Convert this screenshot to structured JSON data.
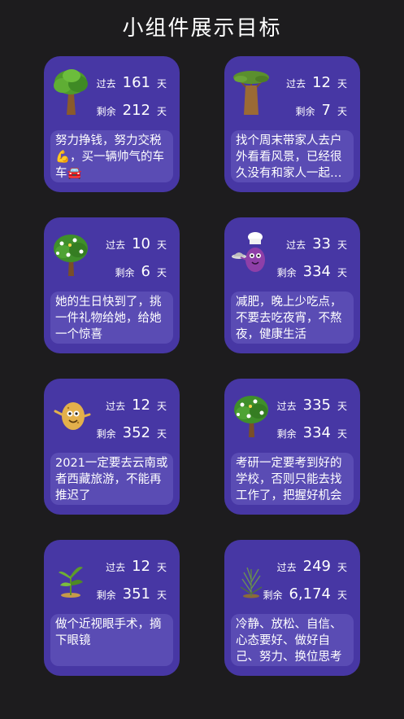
{
  "title": "小组件展示目标",
  "colors": {
    "background": "#1d1c1e",
    "card": "#4737a4",
    "memo": "#5a4cb4"
  },
  "cards": [
    {
      "icon": "tree-icon",
      "passed_label": "过去",
      "passed": "161",
      "passed_unit": "天",
      "left_label": "剩余",
      "left": "212",
      "left_unit": "天",
      "memo": "努力挣钱，努力交税💪，买一辆帅气的车车🚘"
    },
    {
      "icon": "baobab-tree-icon",
      "passed_label": "过去",
      "passed": "12",
      "passed_unit": "天",
      "left_label": "剩余",
      "left": "7",
      "left_unit": "天",
      "memo": "找个周末带家人去户外看看风景，已经很久没有和家人一起…"
    },
    {
      "icon": "flower-tree-icon",
      "passed_label": "过去",
      "passed": "10",
      "passed_unit": "天",
      "left_label": "剩余",
      "left": "6",
      "left_unit": "天",
      "memo": "她的生日快到了，挑一件礼物给她，给她一个惊喜"
    },
    {
      "icon": "chef-eggplant-icon",
      "passed_label": "过去",
      "passed": "33",
      "passed_unit": "天",
      "left_label": "剩余",
      "left": "334",
      "left_unit": "天",
      "memo": "减肥，晚上少吃点，不要去吃夜宵，不熬夜，健康生活"
    },
    {
      "icon": "potato-character-icon",
      "passed_label": "过去",
      "passed": "12",
      "passed_unit": "天",
      "left_label": "剩余",
      "left": "352",
      "left_unit": "天",
      "memo": "2021一定要去云南或者西藏旅游，不能再推迟了"
    },
    {
      "icon": "flower-tree-icon",
      "passed_label": "过去",
      "passed": "335",
      "passed_unit": "天",
      "left_label": "剩余",
      "left": "334",
      "left_unit": "天",
      "memo": "考研一定要考到好的学校，否则只能去找工作了，把握好机会"
    },
    {
      "icon": "sprout-icon",
      "passed_label": "过去",
      "passed": "12",
      "passed_unit": "天",
      "left_label": "剩余",
      "left": "351",
      "left_unit": "天",
      "memo": "做个近视眼手术，摘下眼镜"
    },
    {
      "icon": "grass-plant-icon",
      "passed_label": "过去",
      "passed": "249",
      "passed_unit": "天",
      "left_label": "剩余",
      "left": "6,174",
      "left_unit": "天",
      "memo": "冷静、放松、自信、心态要好、做好自己、努力、换位思考"
    }
  ]
}
